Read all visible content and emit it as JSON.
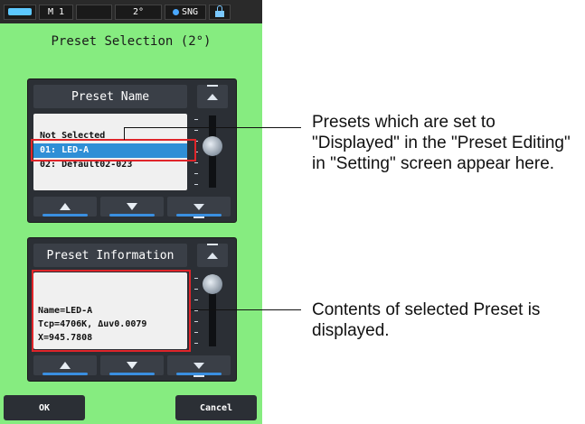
{
  "status_bar": {
    "battery_icon": "battery-icon",
    "mode": "M  1",
    "angle": "2°",
    "sng": "SNG",
    "lock_icon": "lock-icon"
  },
  "screen": {
    "title": "Preset Selection (2°)"
  },
  "preset_name_panel": {
    "header": "Preset Name",
    "items": [
      {
        "label": "Not Selected",
        "selected": false
      },
      {
        "label": "01: LED-A",
        "selected": true
      },
      {
        "label": "02: Default02-023",
        "selected": false
      }
    ],
    "scroll_position": 0.4
  },
  "preset_info_panel": {
    "header": "Preset Information",
    "lines": [
      "Name=LED-A",
      "Tcp=4706K,  Δuv0.0079",
      "X=945.7808"
    ],
    "scroll_position": 0.0
  },
  "buttons": {
    "ok": "OK",
    "cancel": "Cancel"
  },
  "callouts": {
    "preset_list": "Presets which are set to \"Displayed\" in the \"Preset Editing\" in \"Setting\" screen appear here.",
    "preset_info": "Contents of selected Preset is displayed."
  },
  "colors": {
    "screen_bg": "#86ec80",
    "panel_bg": "#2b2f35",
    "selection": "#2f8fd6",
    "highlight_frame": "#e0252a"
  }
}
